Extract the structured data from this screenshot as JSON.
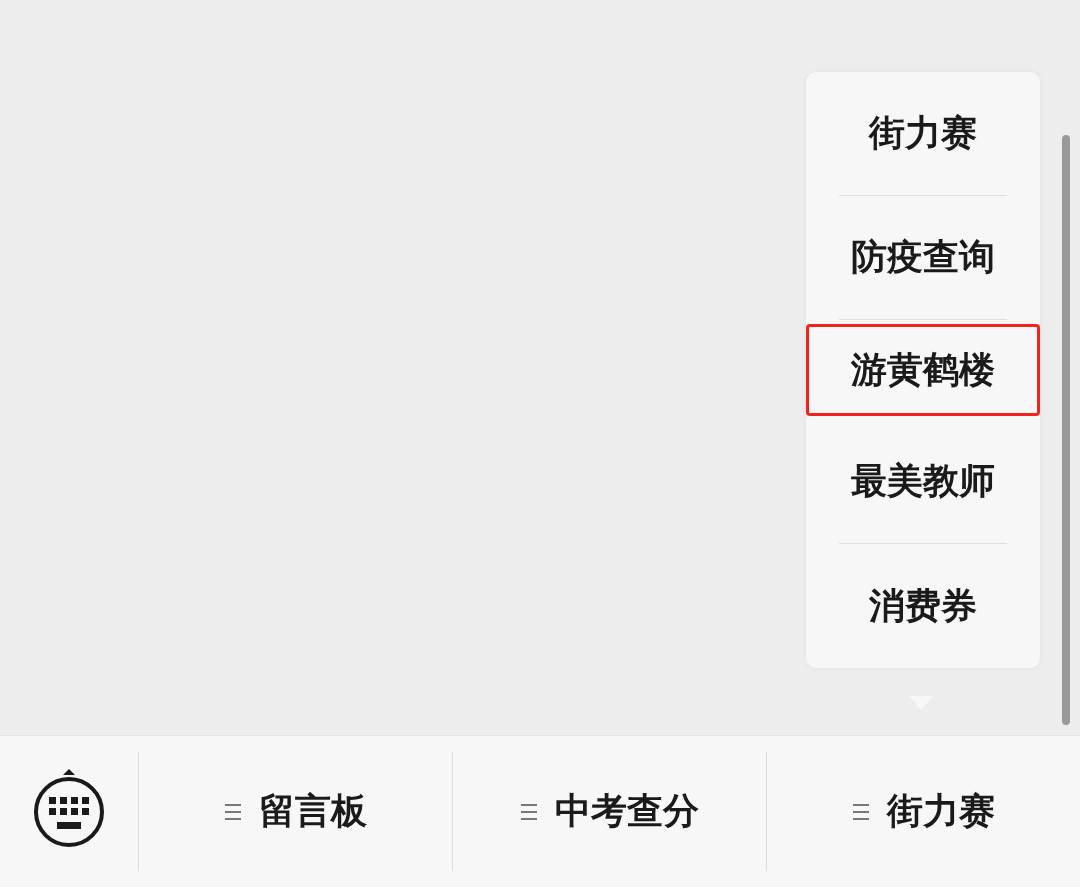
{
  "popup_menu": {
    "items": [
      {
        "label": "街力赛",
        "highlighted": false
      },
      {
        "label": "防疫查询",
        "highlighted": false
      },
      {
        "label": "游黄鹤楼",
        "highlighted": true
      },
      {
        "label": "最美教师",
        "highlighted": false
      },
      {
        "label": "消费券",
        "highlighted": false
      }
    ]
  },
  "menu_bar": {
    "tabs": [
      {
        "label": "留言板"
      },
      {
        "label": "中考查分"
      },
      {
        "label": "街力赛"
      }
    ]
  }
}
